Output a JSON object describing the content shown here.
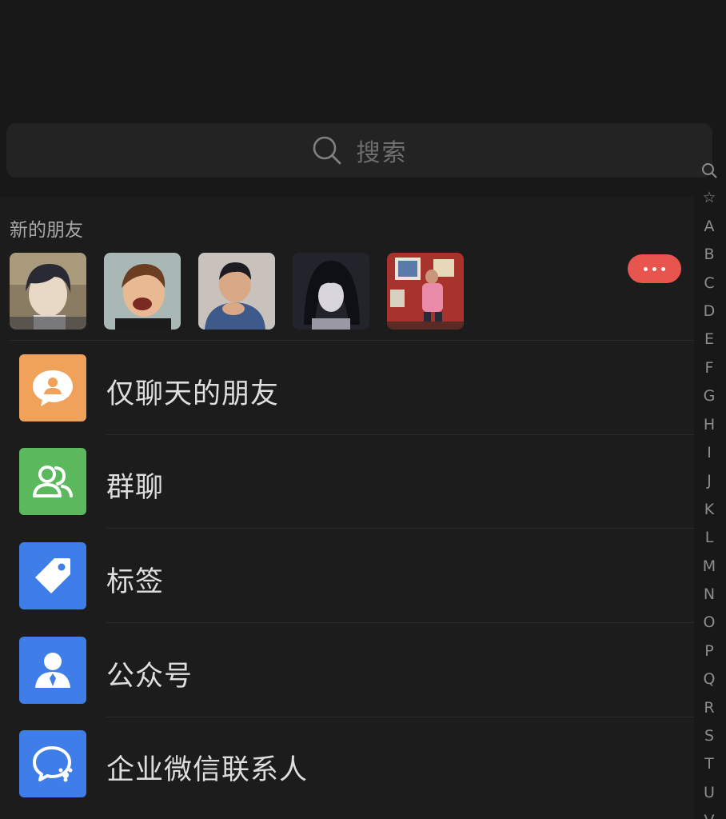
{
  "search": {
    "placeholder": "搜索",
    "icon": "search-icon"
  },
  "new_friends": {
    "title": "新的朋友",
    "avatars": [
      {
        "name": "avatar-anime-boy"
      },
      {
        "name": "avatar-laughing-child"
      },
      {
        "name": "avatar-boy-blue-shirt"
      },
      {
        "name": "avatar-anime-dark-hair"
      },
      {
        "name": "avatar-room-pink-shirt"
      }
    ],
    "more_icon": "more-dots-icon",
    "more_color": "#e8554f"
  },
  "entries": [
    {
      "label": "仅聊天的朋友",
      "icon": "chat-person-icon",
      "color": "#f0a15a"
    },
    {
      "label": "群聊",
      "icon": "group-icon",
      "color": "#5cb85c"
    },
    {
      "label": "标签",
      "icon": "tag-icon",
      "color": "#3f7ee8"
    },
    {
      "label": "公众号",
      "icon": "official-account-icon",
      "color": "#3f7ee8"
    },
    {
      "label": "企业微信联系人",
      "icon": "enterprise-contact-icon",
      "color": "#3f7ee8"
    }
  ],
  "index": [
    "Q",
    "☆",
    "A",
    "B",
    "C",
    "D",
    "E",
    "F",
    "G",
    "H",
    "I",
    "J",
    "K",
    "L",
    "M",
    "N",
    "O",
    "P",
    "Q",
    "R",
    "S",
    "T",
    "U",
    "V"
  ]
}
